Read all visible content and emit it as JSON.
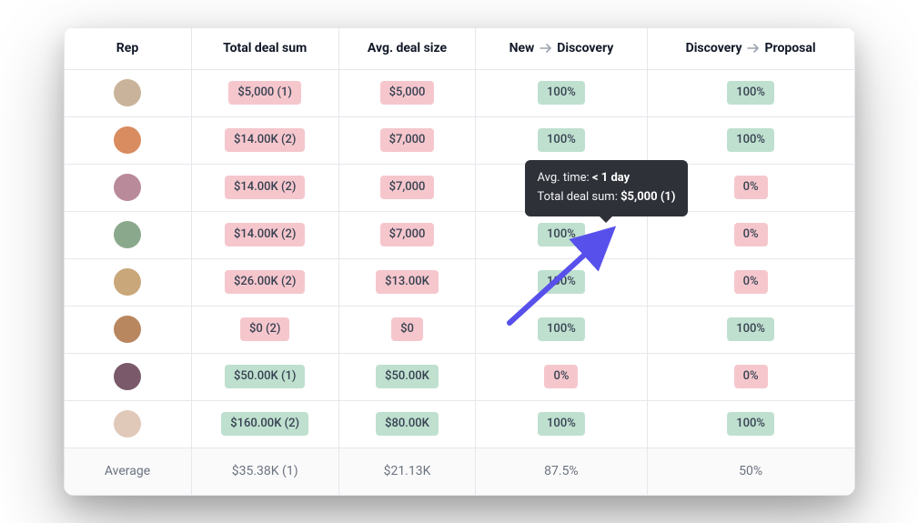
{
  "columns": {
    "rep": "Rep",
    "total": "Total deal sum",
    "avg": "Avg. deal size",
    "stage1_from": "New",
    "stage1_to": "Discovery",
    "stage2_from": "Discovery",
    "stage2_to": "Proposal"
  },
  "rows": [
    {
      "avatar_color": "#c9b39a",
      "total": "$5,000 (1)",
      "total_color": "red",
      "avg": "$5,000",
      "avg_color": "red",
      "stage1": "100%",
      "stage1_color": "green",
      "stage2": "100%",
      "stage2_color": "green"
    },
    {
      "avatar_color": "#d98c5f",
      "total": "$14.00K (2)",
      "total_color": "red",
      "avg": "$7,000",
      "avg_color": "red",
      "stage1": "100%",
      "stage1_color": "green",
      "stage2": "100%",
      "stage2_color": "green"
    },
    {
      "avatar_color": "#b98a9a",
      "total": "$14.00K (2)",
      "total_color": "red",
      "avg": "$7,000",
      "avg_color": "red",
      "stage1": "",
      "stage1_color": "",
      "stage2": "0%",
      "stage2_color": "red"
    },
    {
      "avatar_color": "#8aa98c",
      "total": "$14.00K (2)",
      "total_color": "red",
      "avg": "$7,000",
      "avg_color": "red",
      "stage1": "100%",
      "stage1_color": "green",
      "stage2": "0%",
      "stage2_color": "red"
    },
    {
      "avatar_color": "#c9a77a",
      "total": "$26.00K (2)",
      "total_color": "red",
      "avg": "$13.00K",
      "avg_color": "red",
      "stage1": "100%",
      "stage1_color": "green",
      "stage2": "0%",
      "stage2_color": "red"
    },
    {
      "avatar_color": "#b8865f",
      "total": "$0 (2)",
      "total_color": "red",
      "avg": "$0",
      "avg_color": "red",
      "stage1": "100%",
      "stage1_color": "green",
      "stage2": "100%",
      "stage2_color": "green"
    },
    {
      "avatar_color": "#7a5a6a",
      "total": "$50.00K (1)",
      "total_color": "green",
      "avg": "$50.00K",
      "avg_color": "green",
      "stage1": "0%",
      "stage1_color": "red",
      "stage2": "0%",
      "stage2_color": "red"
    },
    {
      "avatar_color": "#e0c9b8",
      "total": "$160.00K (2)",
      "total_color": "green",
      "avg": "$80.00K",
      "avg_color": "green",
      "stage1": "100%",
      "stage1_color": "green",
      "stage2": "100%",
      "stage2_color": "green"
    }
  ],
  "footer": {
    "label": "Average",
    "total": "$35.38K (1)",
    "avg": "$21.13K",
    "stage1": "87.5%",
    "stage2": "50%"
  },
  "tooltip": {
    "line1_label": "Avg. time: ",
    "line1_value": "< 1 day",
    "line2_label": "Total deal sum: ",
    "line2_value": "$5,000 (1)"
  }
}
